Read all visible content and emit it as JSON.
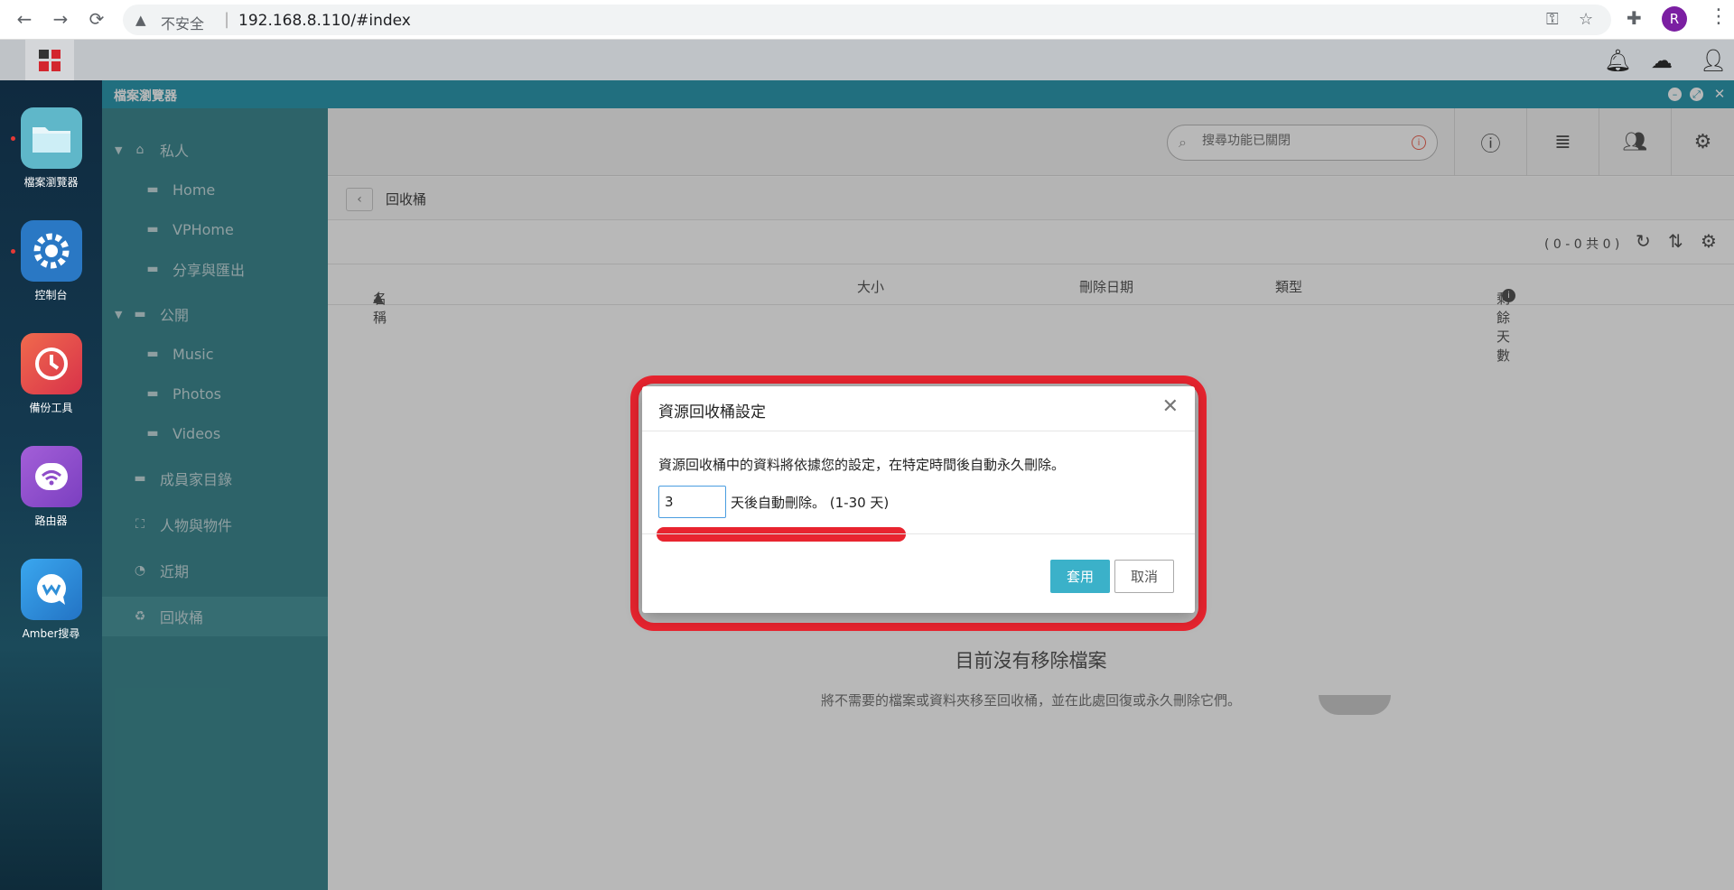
{
  "browser": {
    "security_label": "不安全",
    "separator": "|",
    "url": "192.168.8.110/#index",
    "profile_initial": "R"
  },
  "dock": {
    "items": [
      {
        "label": "檔案瀏覽器",
        "color": "#5fb7c9",
        "icon": "folder-icon"
      },
      {
        "label": "控制台",
        "color": "#2a78c4",
        "icon": "gear-icon"
      },
      {
        "label": "備份工具",
        "color": "#e2494b",
        "icon": "clock-history-icon"
      },
      {
        "label": "路由器",
        "color": "#8e4cc9",
        "icon": "wifi-icon"
      },
      {
        "label": "Amber搜尋",
        "color": "#2f8fd8",
        "icon": "chat-search-icon"
      }
    ]
  },
  "window": {
    "title": "檔案瀏覽器"
  },
  "sidebar": {
    "items": [
      {
        "label": "私人",
        "icon": "home-folder-icon",
        "group": true
      },
      {
        "label": "Home",
        "icon": "folder-icon"
      },
      {
        "label": "VPHome",
        "icon": "folder-icon"
      },
      {
        "label": "分享與匯出",
        "icon": "share-folder-icon"
      },
      {
        "label": "公開",
        "icon": "public-folder-icon",
        "group": true
      },
      {
        "label": "Music",
        "icon": "folder-icon"
      },
      {
        "label": "Photos",
        "icon": "folder-icon"
      },
      {
        "label": "Videos",
        "icon": "folder-icon"
      },
      {
        "label": "成員家目錄",
        "icon": "members-folder-icon"
      },
      {
        "label": "人物與物件",
        "icon": "face-scan-icon"
      },
      {
        "label": "近期",
        "icon": "clock-icon"
      },
      {
        "label": "回收桶",
        "icon": "recycle-bin-icon",
        "active": true
      }
    ]
  },
  "toolbar": {
    "search_placeholder": "搜尋功能已關閉"
  },
  "path": {
    "current": "回收桶"
  },
  "list": {
    "count": "( 0 - 0 共 0 )",
    "columns": [
      "名稱",
      "大小",
      "刪除日期",
      "類型",
      "剩餘天數"
    ],
    "empty_title": "目前沒有移除檔案",
    "empty_sub": "將不需要的檔案或資料夾移至回收桶，並在此處回復或永久刪除它們。"
  },
  "dialog": {
    "title": "資源回收桶設定",
    "description": "資源回收桶中的資料將依據您的設定，在特定時間後自動永久刪除。",
    "days_value": "3",
    "suffix": "天後自動刪除。 (1-30 天)",
    "apply_label": "套用",
    "cancel_label": "取消"
  },
  "colors": {
    "accent": "#3bb1c9",
    "title_bar": "#2f9ab1",
    "highlight": "#e8242f"
  }
}
